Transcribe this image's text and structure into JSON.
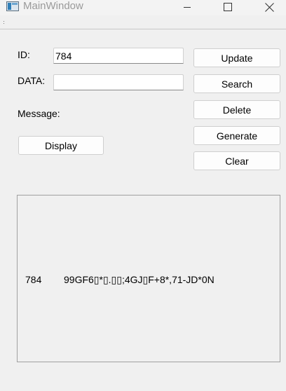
{
  "window": {
    "title": "MainWindow",
    "controls": [
      "minimize-icon",
      "maximize-icon",
      "close-icon"
    ]
  },
  "form": {
    "id_label": "ID:",
    "id_value": "784",
    "data_label": "DATA:",
    "data_value": "",
    "message_label": "Message:"
  },
  "buttons": {
    "update": "Update",
    "search": "Search",
    "delete": "Delete",
    "generate": "Generate",
    "clear": "Clear",
    "display": "Display"
  },
  "output": {
    "rows": [
      {
        "id": "784",
        "data": "99GF6▯*▯.▯▯;4GJ▯F+8*,71-JD*0N"
      }
    ]
  }
}
